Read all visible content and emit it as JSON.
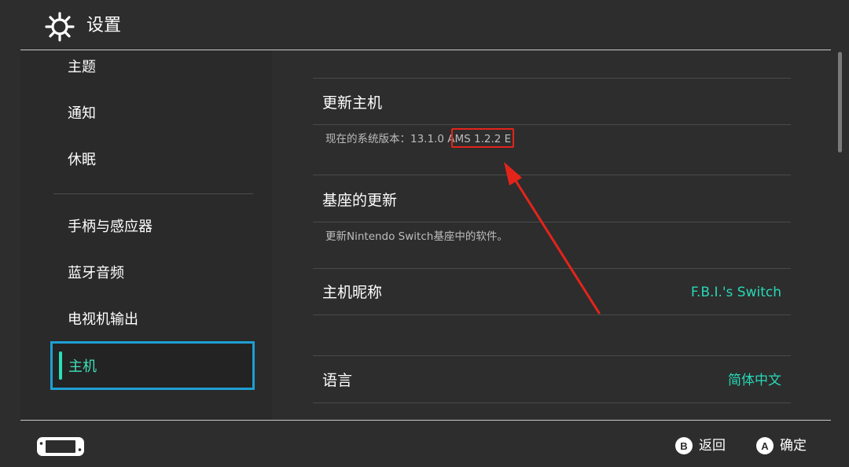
{
  "header": {
    "title": "设置",
    "icon": "gear-icon"
  },
  "sidebar": {
    "items": [
      {
        "label": "主题"
      },
      {
        "label": "通知"
      },
      {
        "label": "休眠"
      },
      {
        "label": "手柄与感应器"
      },
      {
        "label": "蓝牙音频"
      },
      {
        "label": "电视机输出"
      },
      {
        "label": "主机"
      }
    ],
    "selected": "主机",
    "accent_color": "#27e0b8",
    "selection_border_color": "#1e9fd3"
  },
  "main": {
    "update_console": {
      "title": "更新主机",
      "version_prefix": "现在的系统版本：",
      "version_number": "13.1.0",
      "version_ams": "AMS 1.2.2",
      "version_suffix": "E"
    },
    "dock_update": {
      "title": "基座的更新",
      "description": "更新Nintendo Switch基座中的软件。"
    },
    "nickname": {
      "title": "主机昵称",
      "value": "F.B.I.'s Switch"
    },
    "language": {
      "title": "语言",
      "value": "简体中文"
    },
    "value_color": "#27d8b5",
    "highlight_color": "#e3241b"
  },
  "footer": {
    "back": {
      "button": "B",
      "label": "返回"
    },
    "confirm": {
      "button": "A",
      "label": "确定"
    }
  }
}
